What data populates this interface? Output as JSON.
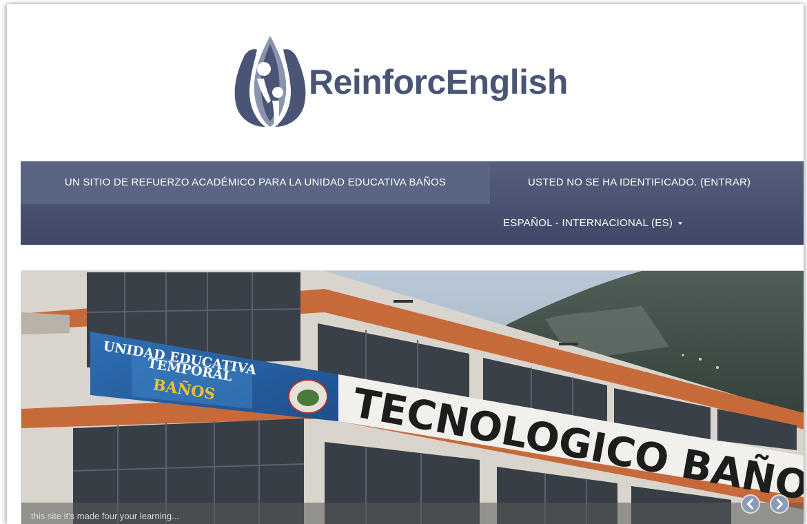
{
  "brand": {
    "name": "ReinforcEnglish",
    "logo_icon": "water-drop-people-logo-icon",
    "colors": {
      "brand": "#4a5575",
      "nav": "#4a5472",
      "nav_highlight": "#5a6583"
    }
  },
  "navbar": {
    "tagline": "UN SITIO DE REFUERZO ACADÉMICO PARA LA UNIDAD EDUCATIVA BAÑOS",
    "login_text": "USTED NO SE HA IDENTIFICADO. (ENTRAR)",
    "language": "ESPAÑOL - INTERNACIONAL (ES)",
    "language_icon": "caret-down-icon"
  },
  "slider": {
    "caption": "this site it's made four your learning...",
    "signs": {
      "line1": "UNIDAD EDUCATIVA",
      "line2": "TEMPORAL",
      "line3": "BAÑOS",
      "building": "TECNOLOGICO BAÑOS"
    },
    "prev_icon": "chevron-left-icon",
    "next_icon": "chevron-right-icon"
  }
}
